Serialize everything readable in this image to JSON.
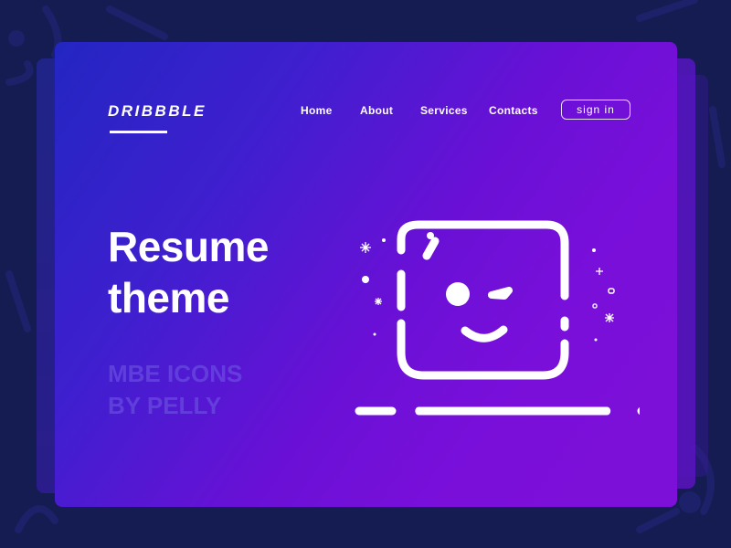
{
  "header": {
    "logo": "DRIBBBLE",
    "nav": [
      {
        "label": "Home"
      },
      {
        "label": "About"
      },
      {
        "label": "Services"
      },
      {
        "label": "Contacts"
      }
    ],
    "sign_in_label": "sign in"
  },
  "hero": {
    "title_line1": "Resume",
    "title_line2": "theme",
    "subtitle_line1": "MBE ICONS",
    "subtitle_line2": "BY PELLY"
  },
  "illustration": {
    "icon": "winking-face-icon"
  },
  "colors": {
    "background": "#141c52",
    "gradient_start": "#2326c2",
    "gradient_end": "#7d10d8",
    "text": "#ffffff"
  }
}
